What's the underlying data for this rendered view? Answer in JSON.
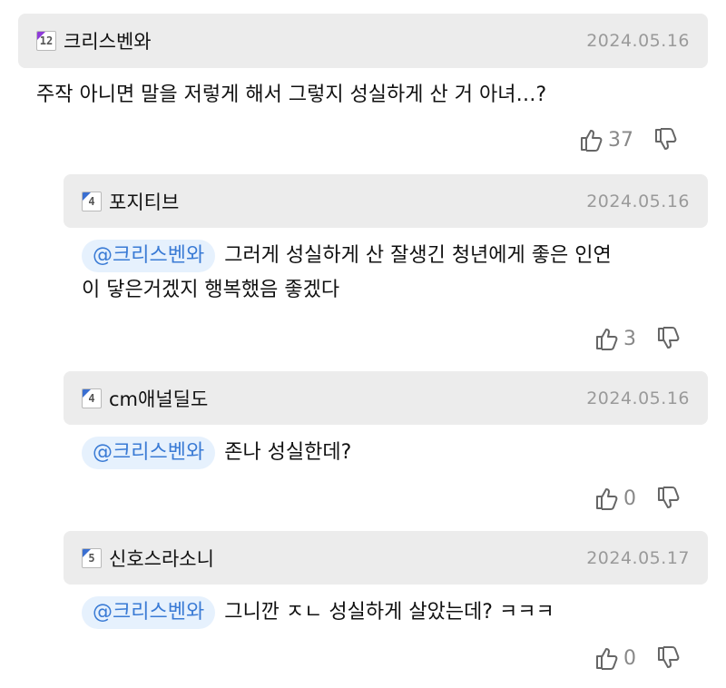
{
  "comments": [
    {
      "nickname": "크리스벤와",
      "level": "12",
      "level_color": "#8e3bd9",
      "date": "2024.05.16",
      "text": "주작 아니면 말을 저렇게 해서 그렇지 성실하게 산 거 아녀…?",
      "likes": "37"
    },
    {
      "nickname": "포지티브",
      "level": "4",
      "level_color": "#3a6fd1",
      "date": "2024.05.16",
      "mention": "@크리스벤와",
      "text_line1": "그러게 성실하게 산 잘생긴 청년에게 좋은 인연",
      "text_line2": "이 닿은거겠지 행복했음 좋겠다",
      "likes": "3"
    },
    {
      "nickname": "cm애널딜도",
      "level": "4",
      "level_color": "#3a6fd1",
      "date": "2024.05.16",
      "mention": "@크리스벤와",
      "text": "존나 성실한데?",
      "likes": "0"
    },
    {
      "nickname": "신호스라소니",
      "level": "5",
      "level_color": "#3a6fd1",
      "date": "2024.05.17",
      "mention": "@크리스벤와",
      "text": "그니깐 ㅈㄴ 성실하게 살았는데? ㅋㅋㅋ",
      "likes": "0"
    }
  ],
  "icons": {
    "like": "thumbs-up-icon",
    "dislike": "thumbs-down-icon"
  }
}
